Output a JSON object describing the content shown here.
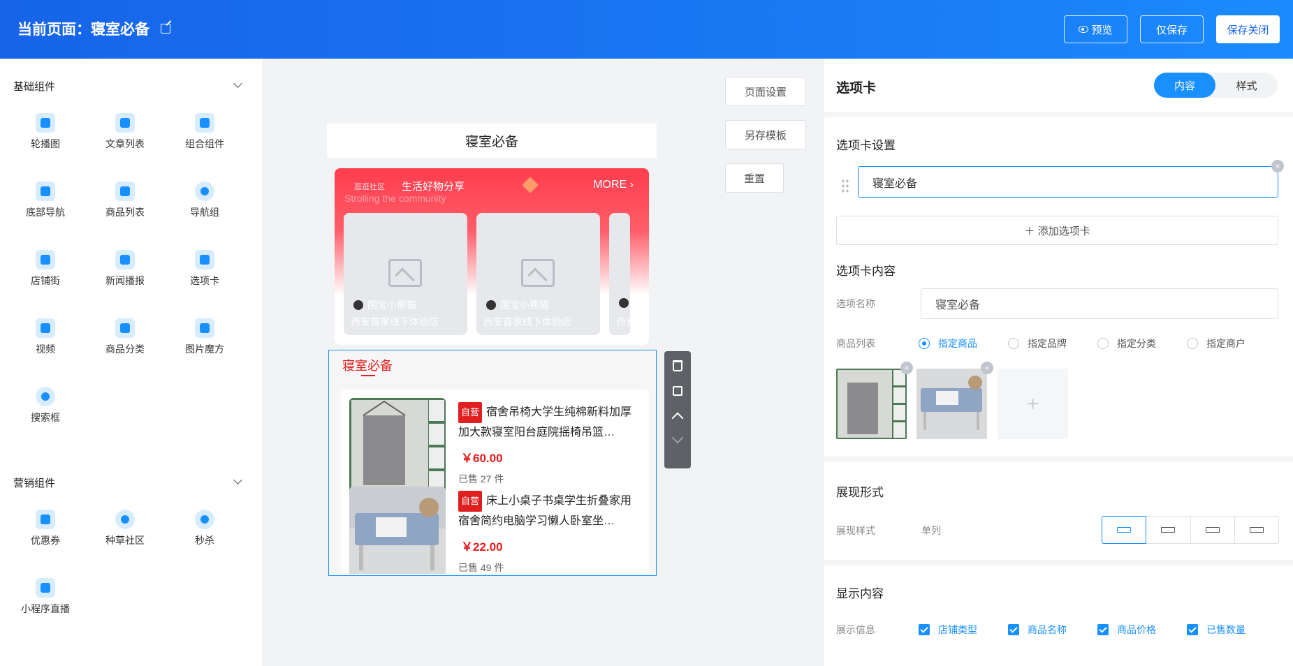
{
  "header": {
    "title": "当前页面：寝室必备",
    "buttons": {
      "preview": "预览",
      "save_only": "仅保存",
      "save_close": "保存关闭"
    }
  },
  "sidebar": {
    "sections": [
      {
        "title": "基础组件",
        "items": [
          {
            "label": "轮播图",
            "icon": "image-icon"
          },
          {
            "label": "文章列表",
            "icon": "article-list-icon"
          },
          {
            "label": "组合组件",
            "icon": "combo-icon"
          },
          {
            "label": "底部导航",
            "icon": "bottom-nav-icon"
          },
          {
            "label": "商品列表",
            "icon": "goods-list-icon"
          },
          {
            "label": "导航组",
            "icon": "nav-arrow-icon"
          },
          {
            "label": "店铺街",
            "icon": "store-icon"
          },
          {
            "label": "新闻播报",
            "icon": "megaphone-icon"
          },
          {
            "label": "选项卡",
            "icon": "tab-icon"
          },
          {
            "label": "视频",
            "icon": "video-icon"
          },
          {
            "label": "商品分类",
            "icon": "category-icon"
          },
          {
            "label": "图片魔方",
            "icon": "image-cube-icon"
          },
          {
            "label": "搜索框",
            "icon": "search-icon"
          }
        ]
      },
      {
        "title": "营销组件",
        "items": [
          {
            "label": "优惠券",
            "icon": "coupon-icon"
          },
          {
            "label": "种草社区",
            "icon": "heart-icon"
          },
          {
            "label": "秒杀",
            "icon": "flash-sale-icon"
          },
          {
            "label": "小程序直播",
            "icon": "live-camera-icon"
          }
        ]
      }
    ]
  },
  "canvas": {
    "side_buttons": {
      "page_settings": "页面设置",
      "save_template": "另存模板",
      "reset": "重置"
    },
    "page_title": "寝室必备",
    "community": {
      "tag": "逛逛社区",
      "heading": "生活好物分享",
      "subheading": "Strolling the community",
      "more": "MORE",
      "cards": [
        {
          "user": "国宝小熊猫",
          "store": "西安首家线下体验店"
        },
        {
          "user": "国宝小熊猫",
          "store": "西安首家线下体验店"
        },
        {
          "user": "",
          "store": "西安"
        }
      ]
    },
    "tab": {
      "name": "寝室必备",
      "goods": [
        {
          "tag": "自营",
          "name": "宿舍吊椅大学生纯棉新料加厚加大款寝室阳台庭院摇椅吊篮…",
          "price": "￥60.00",
          "sold": "已售 27 件"
        },
        {
          "tag": "自营",
          "name": "床上小桌子书桌学生折叠家用宿舍简约电脑学习懒人卧室坐…",
          "price": "￥22.00",
          "sold": "已售 49 件"
        }
      ]
    }
  },
  "panel": {
    "title": "选项卡",
    "tabs": {
      "content": "内容",
      "style": "样式"
    },
    "tab_settings": {
      "heading": "选项卡设置",
      "tab_value": "寝室必备",
      "add_button": "添加选项卡"
    },
    "tab_content": {
      "heading": "选项卡内容",
      "name_label": "选项名称",
      "name_value": "寝室必备",
      "list_label": "商品列表",
      "options": [
        "指定商品",
        "指定品牌",
        "指定分类",
        "指定商户"
      ],
      "selected": "指定商品"
    },
    "display_form": {
      "heading": "展现形式",
      "style_label": "展现样式",
      "style_value": "单列"
    },
    "display_content": {
      "heading": "显示内容",
      "info_label": "展示信息",
      "checks": [
        "店铺类型",
        "商品名称",
        "商品价格",
        "已售数量"
      ]
    }
  },
  "colors": {
    "accent": "#1890ff",
    "header": "#1764e8",
    "price": "#e02020"
  }
}
